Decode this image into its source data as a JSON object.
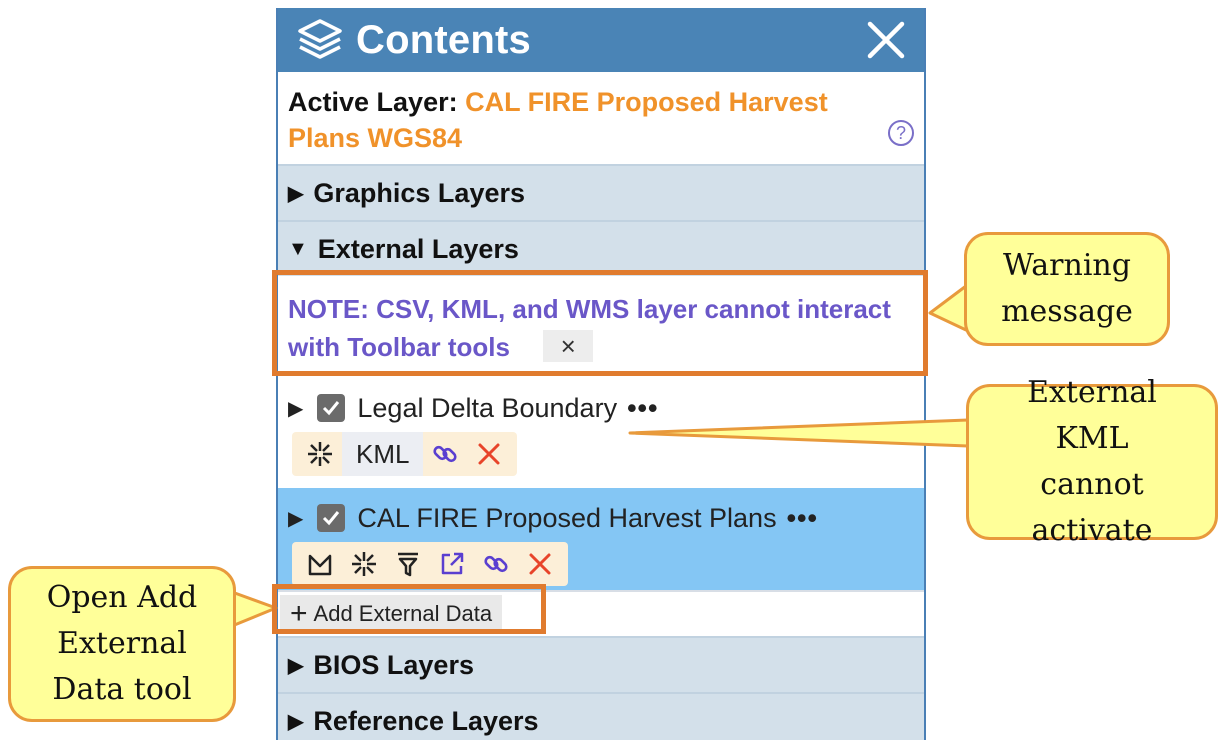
{
  "panel": {
    "title": "Contents",
    "active_layer_label": "Active Layer:",
    "active_layer_value": "CAL FIRE Proposed Harvest Plans WGS84",
    "help_glyph": "?"
  },
  "sections": {
    "graphics": "Graphics Layers",
    "external": "External Layers",
    "bios": "BIOS Layers",
    "reference": "Reference Layers"
  },
  "note": {
    "text": "NOTE: CSV, KML, and WMS layer cannot interact with Toolbar tools",
    "dismiss_glyph": "×"
  },
  "layers": [
    {
      "name": "Legal Delta Boundary",
      "more": "•••",
      "badge": "KML"
    },
    {
      "name": "CAL FIRE Proposed Harvest Plans",
      "more": "•••"
    }
  ],
  "add_external": {
    "plus": "+",
    "label": "Add External Data"
  },
  "callouts": {
    "warning": "Warning message",
    "kml": "External KML cannot activate",
    "add": "Open Add External Data tool"
  },
  "colors": {
    "header": "#4a84b6",
    "active_layer_value": "#f0922a",
    "note_text": "#6a57c8",
    "selected_row": "#84c6f4",
    "highlight": "#e07b2e",
    "callout_fill": "#ffff99"
  }
}
